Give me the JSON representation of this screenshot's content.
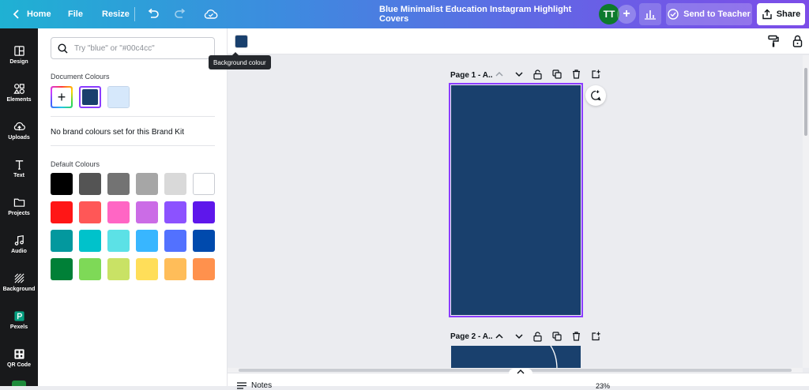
{
  "topbar": {
    "home_label": "Home",
    "file_label": "File",
    "resize_label": "Resize",
    "design_title": "Blue Minimalist Education Instagram Highlight Covers",
    "avatar_initials": "TT",
    "send_label": "Send to Teacher",
    "share_label": "Share"
  },
  "rail": {
    "items": [
      {
        "label": "Design",
        "icon": "design-icon"
      },
      {
        "label": "Elements",
        "icon": "elements-icon"
      },
      {
        "label": "Uploads",
        "icon": "uploads-icon"
      },
      {
        "label": "Text",
        "icon": "text-icon"
      },
      {
        "label": "Projects",
        "icon": "projects-icon"
      },
      {
        "label": "Audio",
        "icon": "audio-icon"
      },
      {
        "label": "Background",
        "icon": "background-icon"
      },
      {
        "label": "Pexels",
        "icon": "pexels-icon"
      },
      {
        "label": "QR Code",
        "icon": "qr-code-icon"
      }
    ]
  },
  "panel": {
    "search_placeholder": "Try \"blue\" or \"#00c4cc\"",
    "document_colours_title": "Document Colours",
    "document_colours": [
      "#19406d",
      "#d6e8fb"
    ],
    "no_brand_text": "No brand colours set for this Brand Kit",
    "default_colours_title": "Default Colours",
    "default_colours": [
      [
        "#000000",
        "#545454",
        "#737373",
        "#a6a6a6",
        "#d9d9d9",
        "#ffffff"
      ],
      [
        "#ff1616",
        "#ff5757",
        "#ff66c4",
        "#cb6ce6",
        "#8c52ff",
        "#5e17eb"
      ],
      [
        "#03989e",
        "#00c2cb",
        "#5ce1e6",
        "#38b6ff",
        "#5271ff",
        "#004aad"
      ],
      [
        "#008037",
        "#7ed957",
        "#c9e265",
        "#ffde59",
        "#ffbd59",
        "#ff914d"
      ]
    ]
  },
  "toolbar": {
    "background_colour": "#19406d",
    "tooltip": "Background colour"
  },
  "canvas": {
    "page1_label": "Page 1 - A...",
    "page2_label": "Page 2 - A...",
    "page_colour": "#19406d",
    "selection_colour": "#8b3dff"
  },
  "bottombar": {
    "notes_label": "Notes",
    "zoom_label": "23%"
  }
}
